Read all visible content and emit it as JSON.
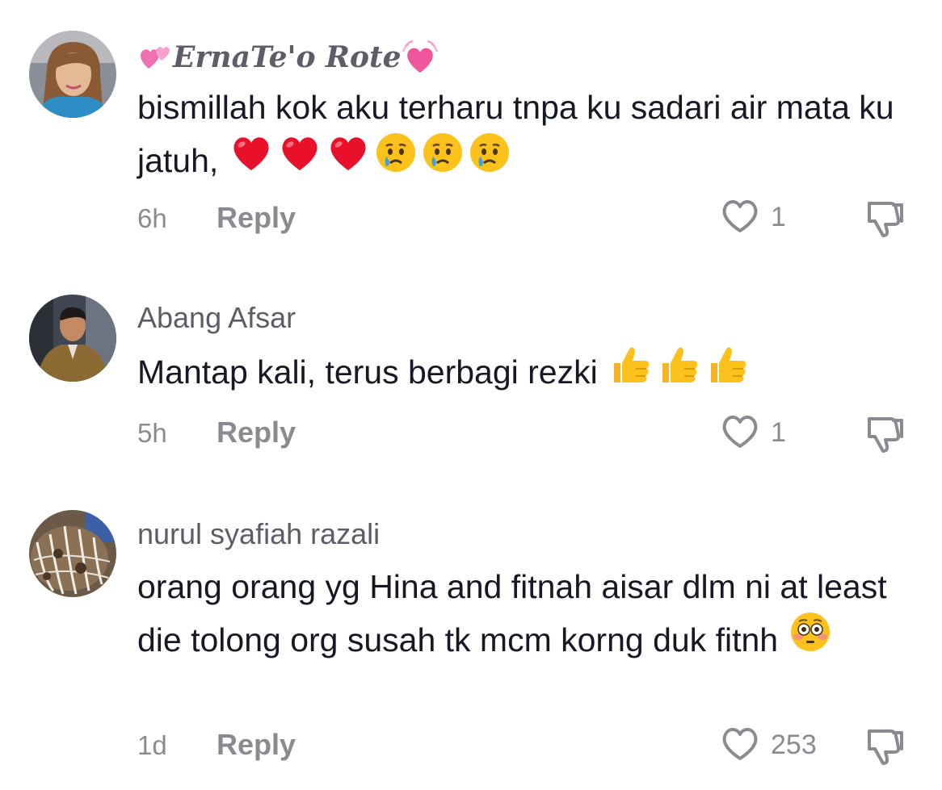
{
  "comments": [
    {
      "username": "ErnaTe'o Rote",
      "text": "bismillah kok aku terharu tnpa ku sadari air mata ku jatuh,",
      "time": "6h",
      "reply_label": "Reply",
      "likes": "1",
      "username_decoration_icons": [
        "two-hearts-icon",
        "growing-heart-icon"
      ],
      "emoji_icons": [
        "red-heart-icon",
        "red-heart-icon",
        "red-heart-icon",
        "crying-face-icon",
        "crying-face-icon",
        "crying-face-icon"
      ]
    },
    {
      "username": "Abang Afsar",
      "text": "Mantap kali, terus berbagi rezki",
      "time": "5h",
      "reply_label": "Reply",
      "likes": "1",
      "emoji_icons": [
        "thumbs-up-icon",
        "thumbs-up-icon",
        "thumbs-up-icon"
      ]
    },
    {
      "username": "nurul syafiah razali",
      "text": "orang orang yg Hina and fitnah aisar dlm ni at least die tolong org susah tk mcm korng duk fitnh",
      "time": "1d",
      "reply_label": "Reply",
      "likes": "253",
      "emoji_icons": [
        "flushed-face-icon"
      ]
    }
  ],
  "colors": {
    "text_primary": "#161823",
    "text_secondary": "#8a8b91",
    "username": "#5c5d66",
    "heart_emoji": "#e8102a",
    "emoji_face": "#fcc21b"
  }
}
